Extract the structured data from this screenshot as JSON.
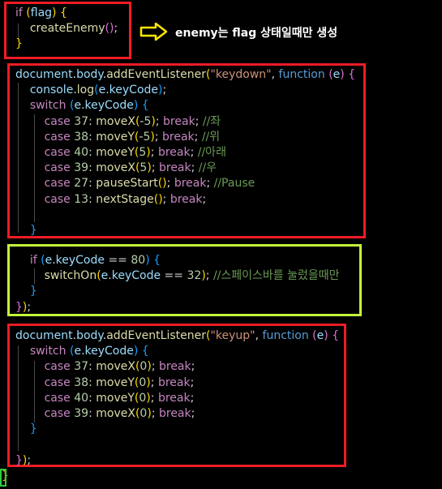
{
  "annotation": {
    "text": "enemy는 flag 상태일때만 생성",
    "arrow_color": "#ffe600"
  },
  "colors": {
    "highlight_red": "#ee1c25",
    "highlight_green": "#c3f73a",
    "background": "#000000"
  },
  "code": {
    "block1": [
      [
        [
          "k",
          "if"
        ],
        [
          "p",
          " "
        ],
        [
          "b1",
          "("
        ],
        [
          "v",
          "flag"
        ],
        [
          "b1",
          ")"
        ],
        [
          "p",
          " "
        ],
        [
          "b1",
          "{"
        ]
      ],
      [
        [
          "p",
          "    "
        ],
        [
          "f",
          "createEnemy"
        ],
        [
          "b2",
          "()"
        ],
        [
          "p",
          ";"
        ]
      ],
      [
        [
          "b1",
          "}"
        ]
      ]
    ],
    "block2": [
      [
        [
          "v",
          "document"
        ],
        [
          "p",
          "."
        ],
        [
          "v",
          "body"
        ],
        [
          "p",
          "."
        ],
        [
          "f",
          "addEventListener"
        ],
        [
          "b1",
          "("
        ],
        [
          "s",
          "\"keydown\""
        ],
        [
          "p",
          ", "
        ],
        [
          "bl",
          "function"
        ],
        [
          "p",
          " "
        ],
        [
          "b2",
          "("
        ],
        [
          "v",
          "e"
        ],
        [
          "b2",
          ")"
        ],
        [
          "p",
          " "
        ],
        [
          "b2",
          "{"
        ]
      ],
      [
        [
          "p",
          "    "
        ],
        [
          "v",
          "console"
        ],
        [
          "p",
          "."
        ],
        [
          "f",
          "log"
        ],
        [
          "b3",
          "("
        ],
        [
          "v",
          "e"
        ],
        [
          "p",
          "."
        ],
        [
          "v",
          "keyCode"
        ],
        [
          "b3",
          ")"
        ],
        [
          "p",
          ";"
        ]
      ],
      [
        [
          "p",
          "    "
        ],
        [
          "k",
          "switch"
        ],
        [
          "p",
          " "
        ],
        [
          "b3",
          "("
        ],
        [
          "v",
          "e"
        ],
        [
          "p",
          "."
        ],
        [
          "v",
          "keyCode"
        ],
        [
          "b3",
          ")"
        ],
        [
          "p",
          " "
        ],
        [
          "b3",
          "{"
        ]
      ],
      [
        [
          "p",
          "        "
        ],
        [
          "k",
          "case"
        ],
        [
          "p",
          " "
        ],
        [
          "n",
          "37"
        ],
        [
          "p",
          ": "
        ],
        [
          "f",
          "moveX"
        ],
        [
          "b1",
          "("
        ],
        [
          "p",
          "-"
        ],
        [
          "n",
          "5"
        ],
        [
          "b1",
          ")"
        ],
        [
          "p",
          "; "
        ],
        [
          "k",
          "break"
        ],
        [
          "p",
          "; "
        ],
        [
          "c",
          "//좌"
        ]
      ],
      [
        [
          "p",
          "        "
        ],
        [
          "k",
          "case"
        ],
        [
          "p",
          " "
        ],
        [
          "n",
          "38"
        ],
        [
          "p",
          ": "
        ],
        [
          "f",
          "moveY"
        ],
        [
          "b1",
          "("
        ],
        [
          "p",
          "-"
        ],
        [
          "n",
          "5"
        ],
        [
          "b1",
          ")"
        ],
        [
          "p",
          "; "
        ],
        [
          "k",
          "break"
        ],
        [
          "p",
          "; "
        ],
        [
          "c",
          "//위"
        ]
      ],
      [
        [
          "p",
          "        "
        ],
        [
          "k",
          "case"
        ],
        [
          "p",
          " "
        ],
        [
          "n",
          "40"
        ],
        [
          "p",
          ": "
        ],
        [
          "f",
          "moveY"
        ],
        [
          "b1",
          "("
        ],
        [
          "n",
          "5"
        ],
        [
          "b1",
          ")"
        ],
        [
          "p",
          "; "
        ],
        [
          "k",
          "break"
        ],
        [
          "p",
          "; "
        ],
        [
          "c",
          "//아래"
        ]
      ],
      [
        [
          "p",
          "        "
        ],
        [
          "k",
          "case"
        ],
        [
          "p",
          " "
        ],
        [
          "n",
          "39"
        ],
        [
          "p",
          ": "
        ],
        [
          "f",
          "moveX"
        ],
        [
          "b1",
          "("
        ],
        [
          "n",
          "5"
        ],
        [
          "b1",
          ")"
        ],
        [
          "p",
          "; "
        ],
        [
          "k",
          "break"
        ],
        [
          "p",
          "; "
        ],
        [
          "c",
          "//우"
        ]
      ],
      [
        [
          "p",
          "        "
        ],
        [
          "k",
          "case"
        ],
        [
          "p",
          " "
        ],
        [
          "n",
          "27"
        ],
        [
          "p",
          ": "
        ],
        [
          "f",
          "pauseStart"
        ],
        [
          "b1",
          "()"
        ],
        [
          "p",
          "; "
        ],
        [
          "k",
          "break"
        ],
        [
          "p",
          "; "
        ],
        [
          "c",
          "//Pause"
        ]
      ],
      [
        [
          "p",
          "        "
        ],
        [
          "k",
          "case"
        ],
        [
          "p",
          " "
        ],
        [
          "n",
          "13"
        ],
        [
          "p",
          ": "
        ],
        [
          "f",
          "nextStage"
        ],
        [
          "b1",
          "()"
        ],
        [
          "p",
          "; "
        ],
        [
          "k",
          "break"
        ],
        [
          "p",
          ";"
        ]
      ],
      [
        [
          "p",
          ""
        ]
      ],
      [
        [
          "p",
          "    "
        ],
        [
          "b3",
          "}"
        ]
      ]
    ],
    "block3": [
      [
        [
          "p",
          "    "
        ],
        [
          "k",
          "if"
        ],
        [
          "p",
          " "
        ],
        [
          "b3",
          "("
        ],
        [
          "v",
          "e"
        ],
        [
          "p",
          "."
        ],
        [
          "v",
          "keyCode"
        ],
        [
          "p",
          " == "
        ],
        [
          "n",
          "80"
        ],
        [
          "b3",
          ")"
        ],
        [
          "p",
          " "
        ],
        [
          "b3",
          "{"
        ]
      ],
      [
        [
          "p",
          "        "
        ],
        [
          "f",
          "switchOn"
        ],
        [
          "b1",
          "("
        ],
        [
          "v",
          "e"
        ],
        [
          "p",
          "."
        ],
        [
          "v",
          "keyCode"
        ],
        [
          "p",
          " == "
        ],
        [
          "n",
          "32"
        ],
        [
          "b1",
          ")"
        ],
        [
          "p",
          "; "
        ],
        [
          "c",
          "//스페이스바를 눌렀을때만"
        ]
      ],
      [
        [
          "p",
          "    "
        ],
        [
          "b3",
          "}"
        ]
      ],
      [
        [
          "b2",
          "}"
        ],
        [
          "b1",
          ")"
        ],
        [
          "p",
          ";"
        ]
      ]
    ],
    "block4": [
      [
        [
          "v",
          "document"
        ],
        [
          "p",
          "."
        ],
        [
          "v",
          "body"
        ],
        [
          "p",
          "."
        ],
        [
          "f",
          "addEventListener"
        ],
        [
          "b1",
          "("
        ],
        [
          "s",
          "\"keyup\""
        ],
        [
          "p",
          ", "
        ],
        [
          "bl",
          "function"
        ],
        [
          "p",
          " "
        ],
        [
          "b2",
          "("
        ],
        [
          "v",
          "e"
        ],
        [
          "b2",
          ")"
        ],
        [
          "p",
          " "
        ],
        [
          "b2",
          "{"
        ]
      ],
      [
        [
          "p",
          "    "
        ],
        [
          "k",
          "switch"
        ],
        [
          "p",
          " "
        ],
        [
          "b3",
          "("
        ],
        [
          "v",
          "e"
        ],
        [
          "p",
          "."
        ],
        [
          "v",
          "keyCode"
        ],
        [
          "b3",
          ")"
        ],
        [
          "p",
          " "
        ],
        [
          "b3",
          "{"
        ]
      ],
      [
        [
          "p",
          "        "
        ],
        [
          "k",
          "case"
        ],
        [
          "p",
          " "
        ],
        [
          "n",
          "37"
        ],
        [
          "p",
          ": "
        ],
        [
          "f",
          "moveX"
        ],
        [
          "b1",
          "("
        ],
        [
          "n",
          "0"
        ],
        [
          "b1",
          ")"
        ],
        [
          "p",
          "; "
        ],
        [
          "k",
          "break"
        ],
        [
          "p",
          ";"
        ]
      ],
      [
        [
          "p",
          "        "
        ],
        [
          "k",
          "case"
        ],
        [
          "p",
          " "
        ],
        [
          "n",
          "38"
        ],
        [
          "p",
          ": "
        ],
        [
          "f",
          "moveY"
        ],
        [
          "b1",
          "("
        ],
        [
          "n",
          "0"
        ],
        [
          "b1",
          ")"
        ],
        [
          "p",
          "; "
        ],
        [
          "k",
          "break"
        ],
        [
          "p",
          ";"
        ]
      ],
      [
        [
          "p",
          "        "
        ],
        [
          "k",
          "case"
        ],
        [
          "p",
          " "
        ],
        [
          "n",
          "40"
        ],
        [
          "p",
          ": "
        ],
        [
          "f",
          "moveY"
        ],
        [
          "b1",
          "("
        ],
        [
          "n",
          "0"
        ],
        [
          "b1",
          ")"
        ],
        [
          "p",
          "; "
        ],
        [
          "k",
          "break"
        ],
        [
          "p",
          ";"
        ]
      ],
      [
        [
          "p",
          "        "
        ],
        [
          "k",
          "case"
        ],
        [
          "p",
          " "
        ],
        [
          "n",
          "39"
        ],
        [
          "p",
          ": "
        ],
        [
          "f",
          "moveX"
        ],
        [
          "b1",
          "("
        ],
        [
          "n",
          "0"
        ],
        [
          "b1",
          ")"
        ],
        [
          "p",
          "; "
        ],
        [
          "k",
          "break"
        ],
        [
          "p",
          ";"
        ]
      ],
      [
        [
          "p",
          "    "
        ],
        [
          "b3",
          "}"
        ]
      ],
      [
        [
          "p",
          ""
        ]
      ],
      [
        [
          "b2",
          "}"
        ],
        [
          "b1",
          ")"
        ],
        [
          "p",
          ";"
        ]
      ]
    ],
    "closing": [
      [
        [
          "b1",
          "}"
        ]
      ]
    ]
  }
}
